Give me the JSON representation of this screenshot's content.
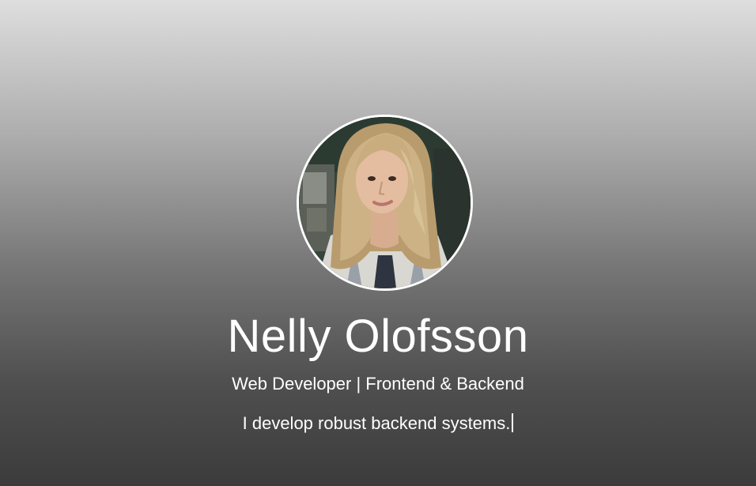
{
  "profile": {
    "name": "Nelly Olofsson",
    "role": "Web Developer | Frontend & Backend",
    "tagline": "I develop robust backend systems.",
    "avatar_icon": "profile-photo"
  },
  "colors": {
    "background_top": "#dedede",
    "background_bottom": "#3b3b3b",
    "text": "#ffffff",
    "avatar_border": "#ffffff"
  }
}
